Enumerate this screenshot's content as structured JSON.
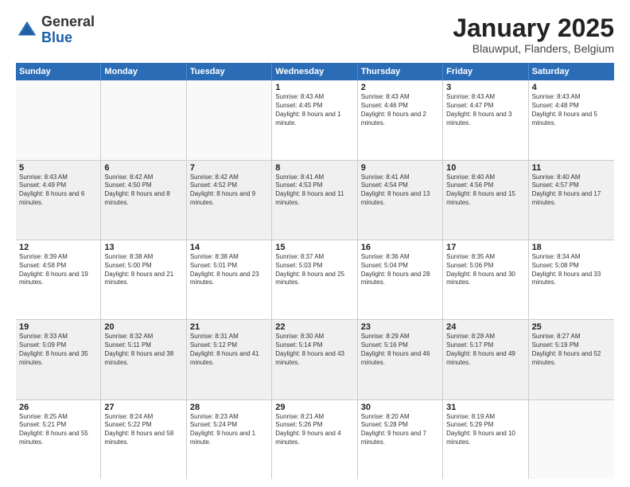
{
  "header": {
    "logo_general": "General",
    "logo_blue": "Blue",
    "month": "January 2025",
    "location": "Blauwput, Flanders, Belgium"
  },
  "days_of_week": [
    "Sunday",
    "Monday",
    "Tuesday",
    "Wednesday",
    "Thursday",
    "Friday",
    "Saturday"
  ],
  "weeks": [
    [
      {
        "day": "",
        "empty": true
      },
      {
        "day": "",
        "empty": true
      },
      {
        "day": "",
        "empty": true
      },
      {
        "day": "1",
        "sunrise": "8:43 AM",
        "sunset": "4:45 PM",
        "daylight": "8 hours and 1 minute."
      },
      {
        "day": "2",
        "sunrise": "8:43 AM",
        "sunset": "4:46 PM",
        "daylight": "8 hours and 2 minutes."
      },
      {
        "day": "3",
        "sunrise": "8:43 AM",
        "sunset": "4:47 PM",
        "daylight": "8 hours and 3 minutes."
      },
      {
        "day": "4",
        "sunrise": "8:43 AM",
        "sunset": "4:48 PM",
        "daylight": "8 hours and 5 minutes."
      }
    ],
    [
      {
        "day": "5",
        "sunrise": "8:43 AM",
        "sunset": "4:49 PM",
        "daylight": "8 hours and 6 minutes."
      },
      {
        "day": "6",
        "sunrise": "8:42 AM",
        "sunset": "4:50 PM",
        "daylight": "8 hours and 8 minutes."
      },
      {
        "day": "7",
        "sunrise": "8:42 AM",
        "sunset": "4:52 PM",
        "daylight": "8 hours and 9 minutes."
      },
      {
        "day": "8",
        "sunrise": "8:41 AM",
        "sunset": "4:53 PM",
        "daylight": "8 hours and 11 minutes."
      },
      {
        "day": "9",
        "sunrise": "8:41 AM",
        "sunset": "4:54 PM",
        "daylight": "8 hours and 13 minutes."
      },
      {
        "day": "10",
        "sunrise": "8:40 AM",
        "sunset": "4:56 PM",
        "daylight": "8 hours and 15 minutes."
      },
      {
        "day": "11",
        "sunrise": "8:40 AM",
        "sunset": "4:57 PM",
        "daylight": "8 hours and 17 minutes."
      }
    ],
    [
      {
        "day": "12",
        "sunrise": "8:39 AM",
        "sunset": "4:58 PM",
        "daylight": "8 hours and 19 minutes."
      },
      {
        "day": "13",
        "sunrise": "8:38 AM",
        "sunset": "5:00 PM",
        "daylight": "8 hours and 21 minutes."
      },
      {
        "day": "14",
        "sunrise": "8:38 AM",
        "sunset": "5:01 PM",
        "daylight": "8 hours and 23 minutes."
      },
      {
        "day": "15",
        "sunrise": "8:37 AM",
        "sunset": "5:03 PM",
        "daylight": "8 hours and 25 minutes."
      },
      {
        "day": "16",
        "sunrise": "8:36 AM",
        "sunset": "5:04 PM",
        "daylight": "8 hours and 28 minutes."
      },
      {
        "day": "17",
        "sunrise": "8:35 AM",
        "sunset": "5:06 PM",
        "daylight": "8 hours and 30 minutes."
      },
      {
        "day": "18",
        "sunrise": "8:34 AM",
        "sunset": "5:08 PM",
        "daylight": "8 hours and 33 minutes."
      }
    ],
    [
      {
        "day": "19",
        "sunrise": "8:33 AM",
        "sunset": "5:09 PM",
        "daylight": "8 hours and 35 minutes."
      },
      {
        "day": "20",
        "sunrise": "8:32 AM",
        "sunset": "5:11 PM",
        "daylight": "8 hours and 38 minutes."
      },
      {
        "day": "21",
        "sunrise": "8:31 AM",
        "sunset": "5:12 PM",
        "daylight": "8 hours and 41 minutes."
      },
      {
        "day": "22",
        "sunrise": "8:30 AM",
        "sunset": "5:14 PM",
        "daylight": "8 hours and 43 minutes."
      },
      {
        "day": "23",
        "sunrise": "8:29 AM",
        "sunset": "5:16 PM",
        "daylight": "8 hours and 46 minutes."
      },
      {
        "day": "24",
        "sunrise": "8:28 AM",
        "sunset": "5:17 PM",
        "daylight": "8 hours and 49 minutes."
      },
      {
        "day": "25",
        "sunrise": "8:27 AM",
        "sunset": "5:19 PM",
        "daylight": "8 hours and 52 minutes."
      }
    ],
    [
      {
        "day": "26",
        "sunrise": "8:25 AM",
        "sunset": "5:21 PM",
        "daylight": "8 hours and 55 minutes."
      },
      {
        "day": "27",
        "sunrise": "8:24 AM",
        "sunset": "5:22 PM",
        "daylight": "8 hours and 58 minutes."
      },
      {
        "day": "28",
        "sunrise": "8:23 AM",
        "sunset": "5:24 PM",
        "daylight": "9 hours and 1 minute."
      },
      {
        "day": "29",
        "sunrise": "8:21 AM",
        "sunset": "5:26 PM",
        "daylight": "9 hours and 4 minutes."
      },
      {
        "day": "30",
        "sunrise": "8:20 AM",
        "sunset": "5:28 PM",
        "daylight": "9 hours and 7 minutes."
      },
      {
        "day": "31",
        "sunrise": "8:19 AM",
        "sunset": "5:29 PM",
        "daylight": "9 hours and 10 minutes."
      },
      {
        "day": "",
        "empty": true
      }
    ]
  ]
}
